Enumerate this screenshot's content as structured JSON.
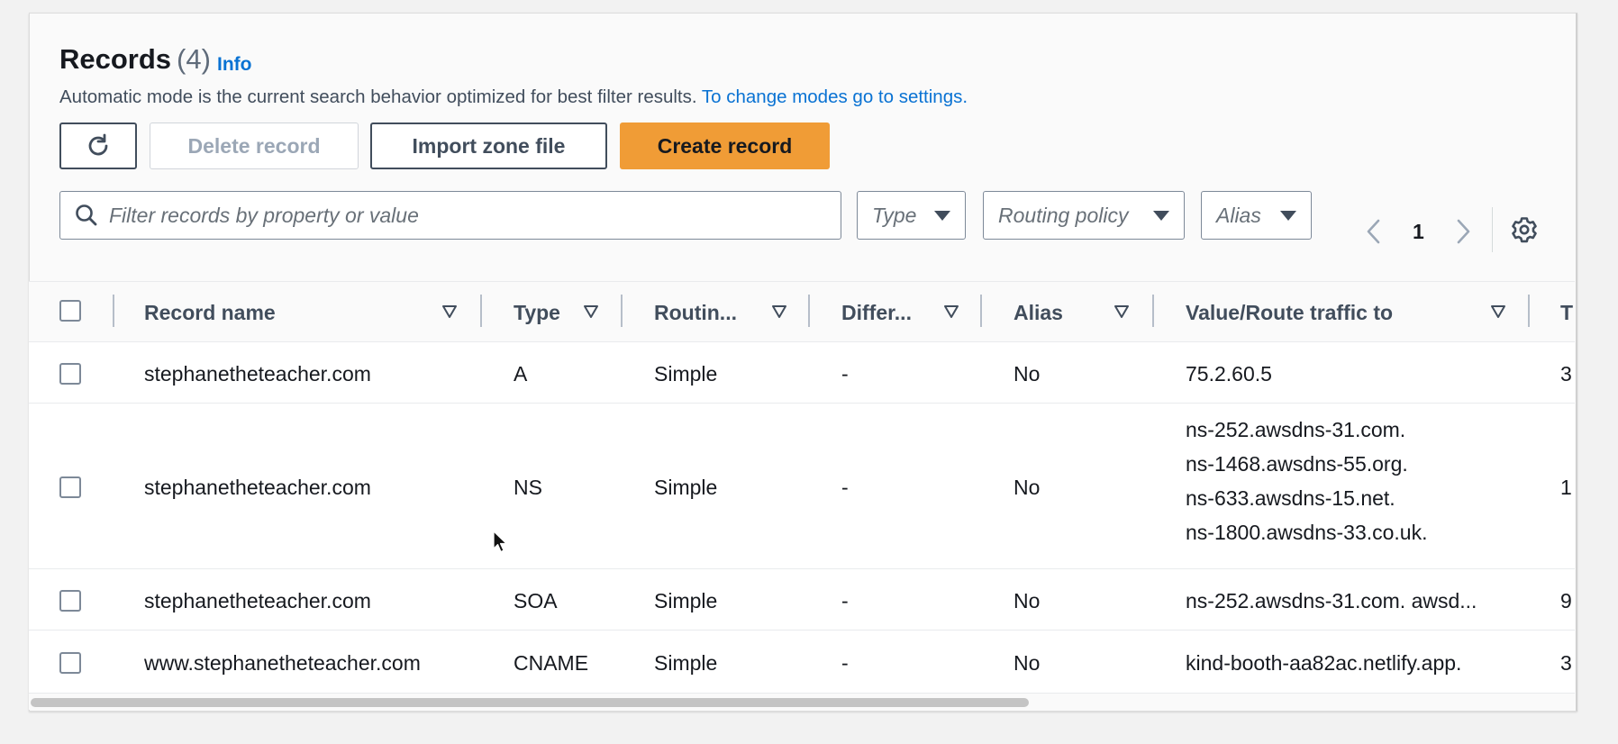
{
  "header": {
    "title": "Records",
    "count": "(4)",
    "info": "Info",
    "description": "Automatic mode is the current search behavior optimized for best filter results.",
    "description_link": "To change modes go to settings."
  },
  "toolbar": {
    "refresh_icon": "refresh-icon",
    "delete_label": "Delete record",
    "import_label": "Import zone file",
    "create_label": "Create record"
  },
  "filters": {
    "search_placeholder": "Filter records by property or value",
    "type_label": "Type",
    "routing_label": "Routing policy",
    "alias_label": "Alias"
  },
  "pagination": {
    "page": "1"
  },
  "columns": [
    "Record name",
    "Type",
    "Routin...",
    "Differ...",
    "Alias",
    "Value/Route traffic to",
    "T"
  ],
  "rows": [
    {
      "name": "stephanetheteacher.com",
      "type": "A",
      "routing": "Simple",
      "differ": "-",
      "alias": "No",
      "value": [
        "75.2.60.5"
      ],
      "ttl": "3"
    },
    {
      "name": "stephanetheteacher.com",
      "type": "NS",
      "routing": "Simple",
      "differ": "-",
      "alias": "No",
      "value": [
        "ns-252.awsdns-31.com.",
        "ns-1468.awsdns-55.org.",
        "ns-633.awsdns-15.net.",
        "ns-1800.awsdns-33.co.uk."
      ],
      "ttl": "1"
    },
    {
      "name": "stephanetheteacher.com",
      "type": "SOA",
      "routing": "Simple",
      "differ": "-",
      "alias": "No",
      "value": [
        "ns-252.awsdns-31.com. awsd..."
      ],
      "ttl": "9"
    },
    {
      "name": "www.stephanetheteacher.com",
      "type": "CNAME",
      "routing": "Simple",
      "differ": "-",
      "alias": "No",
      "value": [
        "kind-booth-aa82ac.netlify.app."
      ],
      "ttl": "3"
    }
  ],
  "colors": {
    "accent_link": "#0972d3",
    "primary_button": "#f09c36",
    "text": "#16191f"
  }
}
